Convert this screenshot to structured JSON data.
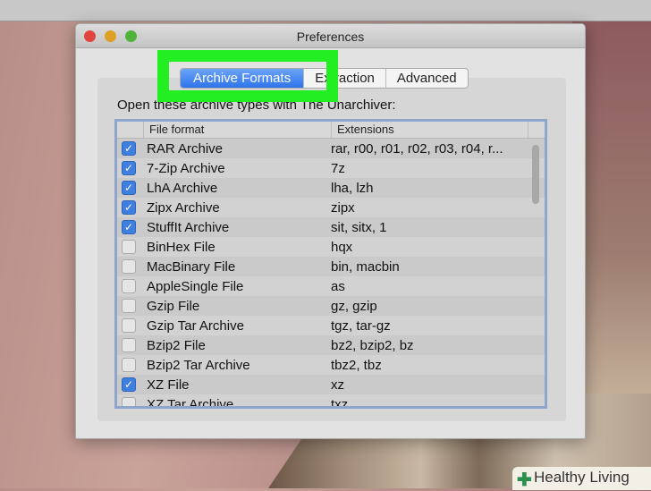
{
  "window": {
    "title": "Preferences"
  },
  "tabs": [
    {
      "label": "Archive Formats",
      "selected": true
    },
    {
      "label": "Extraction",
      "selected": false
    },
    {
      "label": "Advanced",
      "selected": false
    }
  ],
  "intro": "Open these archive types with The Unarchiver:",
  "table": {
    "columns": [
      "File format",
      "Extensions"
    ],
    "rows": [
      {
        "checked": true,
        "format": "RAR Archive",
        "ext": "rar, r00, r01, r02, r03, r04, r..."
      },
      {
        "checked": true,
        "format": "7-Zip Archive",
        "ext": "7z"
      },
      {
        "checked": true,
        "format": "LhA Archive",
        "ext": "lha, lzh"
      },
      {
        "checked": true,
        "format": "Zipx Archive",
        "ext": "zipx"
      },
      {
        "checked": true,
        "format": "StuffIt Archive",
        "ext": "sit, sitx, 1"
      },
      {
        "checked": false,
        "format": "BinHex File",
        "ext": "hqx"
      },
      {
        "checked": false,
        "format": "MacBinary File",
        "ext": "bin, macbin"
      },
      {
        "checked": false,
        "format": "AppleSingle File",
        "ext": "as"
      },
      {
        "checked": false,
        "format": "Gzip File",
        "ext": "gz, gzip"
      },
      {
        "checked": false,
        "format": "Gzip Tar Archive",
        "ext": "tgz, tar-gz"
      },
      {
        "checked": false,
        "format": "Bzip2 File",
        "ext": "bz2, bzip2, bz"
      },
      {
        "checked": false,
        "format": "Bzip2 Tar Archive",
        "ext": "tbz2, tbz"
      },
      {
        "checked": true,
        "format": "XZ File",
        "ext": "xz"
      },
      {
        "checked": false,
        "format": "XZ Tar Archive",
        "ext": "txz"
      }
    ]
  },
  "watermark": "Healthy Living",
  "colors": {
    "highlight": "#22ee22",
    "accent": "#3f7fe0"
  }
}
